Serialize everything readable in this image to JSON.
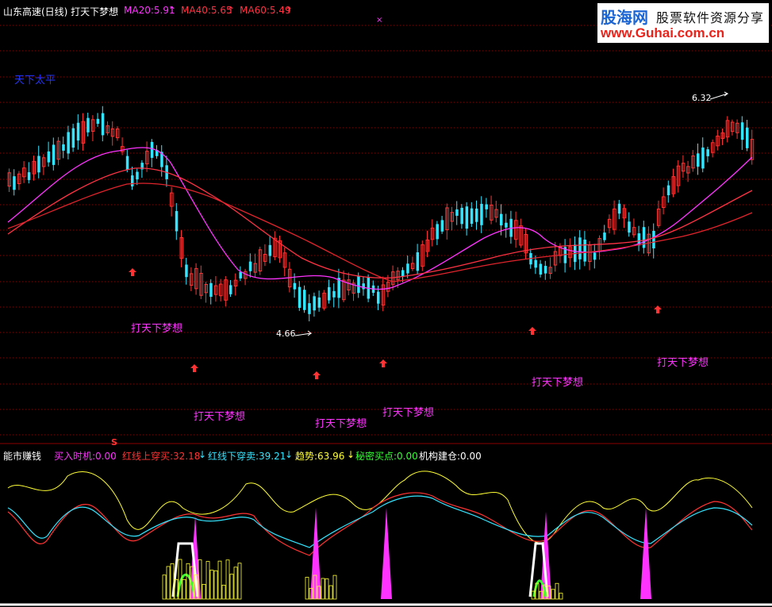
{
  "header": {
    "title": "山东高速(日线) 打天下梦想",
    "ma20": "MA20:5.91",
    "ma40": "MA40:5.65",
    "ma60": "MA60:5.49",
    "cross_marker": "×"
  },
  "main_chart": {
    "watermark_label": "天下太平",
    "high_label": "6.32",
    "low_label": "4.66",
    "signal_text": "打天下梦想",
    "signal_count": 7,
    "colors": {
      "up": "#ff3333",
      "down": "#33e5ff",
      "ma20": "#ff33ff",
      "ma40": "#ff3344",
      "ma60": "#e0242c",
      "grid": "#8b0000"
    }
  },
  "sub_chart": {
    "title": "能市赚钱",
    "buy_timing": "买入时机:0.00",
    "red_cross_up": "红线上穿买:32.18",
    "red_cross_down": "红线下穿卖:39.21",
    "trend": "趋势:63.96",
    "secret_buy": "秘密买点:0.00",
    "institution": "机构建仓:0.00",
    "s_marker": "S",
    "arrow_down": "↓"
  },
  "logo": {
    "name": "股海网",
    "slogan": "股票软件资源分享",
    "url": "www.Guhai.com.cn"
  }
}
